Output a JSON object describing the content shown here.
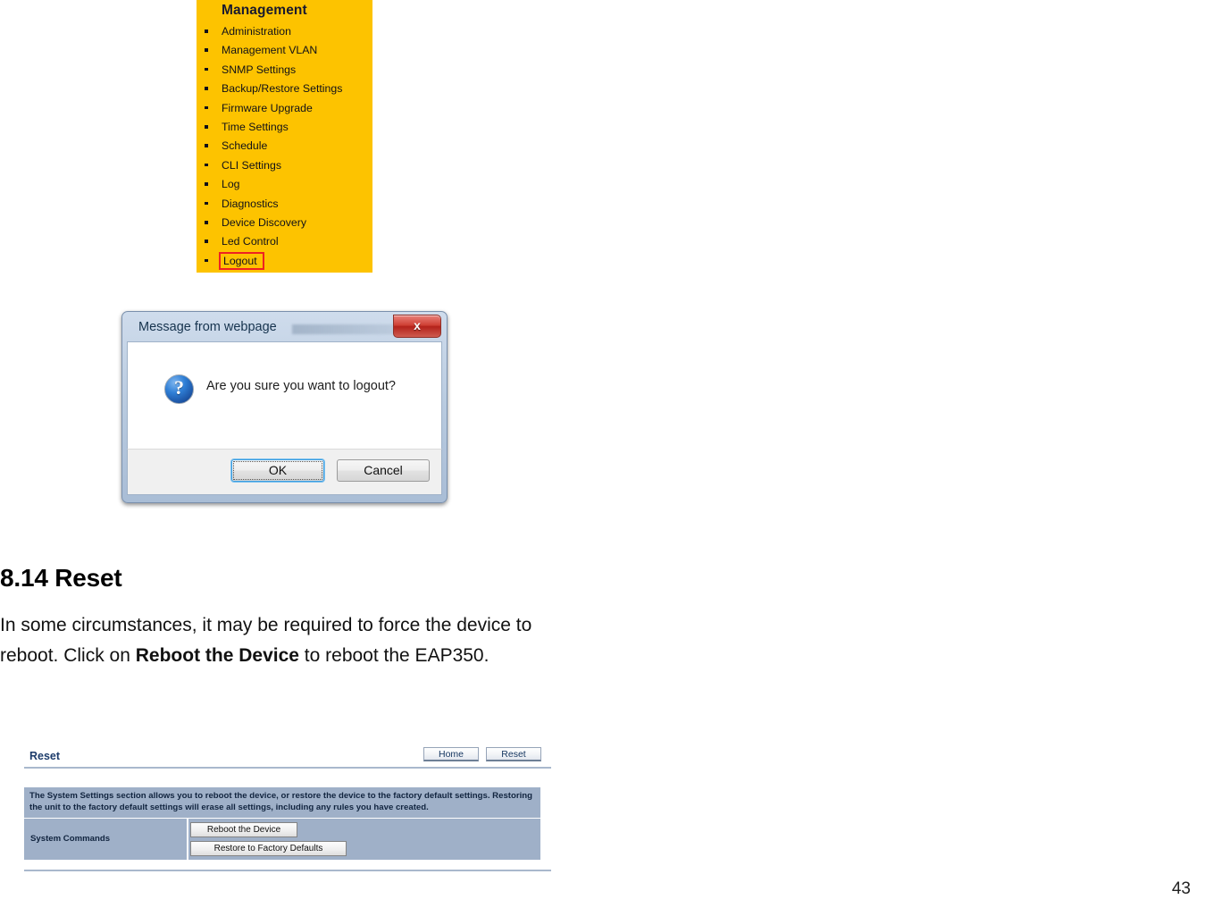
{
  "management_menu": {
    "title": "Management",
    "items": [
      {
        "label": "Administration",
        "highlighted": false
      },
      {
        "label": "Management VLAN",
        "highlighted": false
      },
      {
        "label": "SNMP Settings",
        "highlighted": false
      },
      {
        "label": "Backup/Restore Settings",
        "highlighted": false
      },
      {
        "label": "Firmware Upgrade",
        "highlighted": false
      },
      {
        "label": "Time Settings",
        "highlighted": false
      },
      {
        "label": "Schedule",
        "highlighted": false
      },
      {
        "label": "CLI Settings",
        "highlighted": false
      },
      {
        "label": "Log",
        "highlighted": false
      },
      {
        "label": "Diagnostics",
        "highlighted": false
      },
      {
        "label": "Device Discovery",
        "highlighted": false
      },
      {
        "label": "Led Control",
        "highlighted": false
      },
      {
        "label": "Logout",
        "highlighted": true
      }
    ],
    "background_color": "#fdc300",
    "highlight_color": "#ee2222"
  },
  "dialog": {
    "title": "Message from webpage",
    "close_label": "x",
    "icon": "question-mark-icon",
    "message": "Are you sure you want to logout?",
    "ok_label": "OK",
    "cancel_label": "Cancel"
  },
  "document": {
    "heading": "8.14 Reset",
    "paragraph_part1": "In some circumstances, it may be required to force the device to reboot. Click on ",
    "paragraph_bold": "Reboot the Device",
    "paragraph_part2": " to reboot the EAP350.",
    "page_number": "43"
  },
  "reset_panel": {
    "title": "Reset",
    "home_button": "Home",
    "reset_button": "Reset",
    "description": "The System Settings section allows you to reboot the device, or restore the device to the factory default settings. Restoring the unit to the factory default settings will erase all settings, including any rules you have created.",
    "row_label": "System Commands",
    "reboot_button": "Reboot the Device",
    "restore_button": "Restore to Factory Defaults",
    "panel_color": "#9fb0c8",
    "title_color": "#1d3c6b"
  }
}
